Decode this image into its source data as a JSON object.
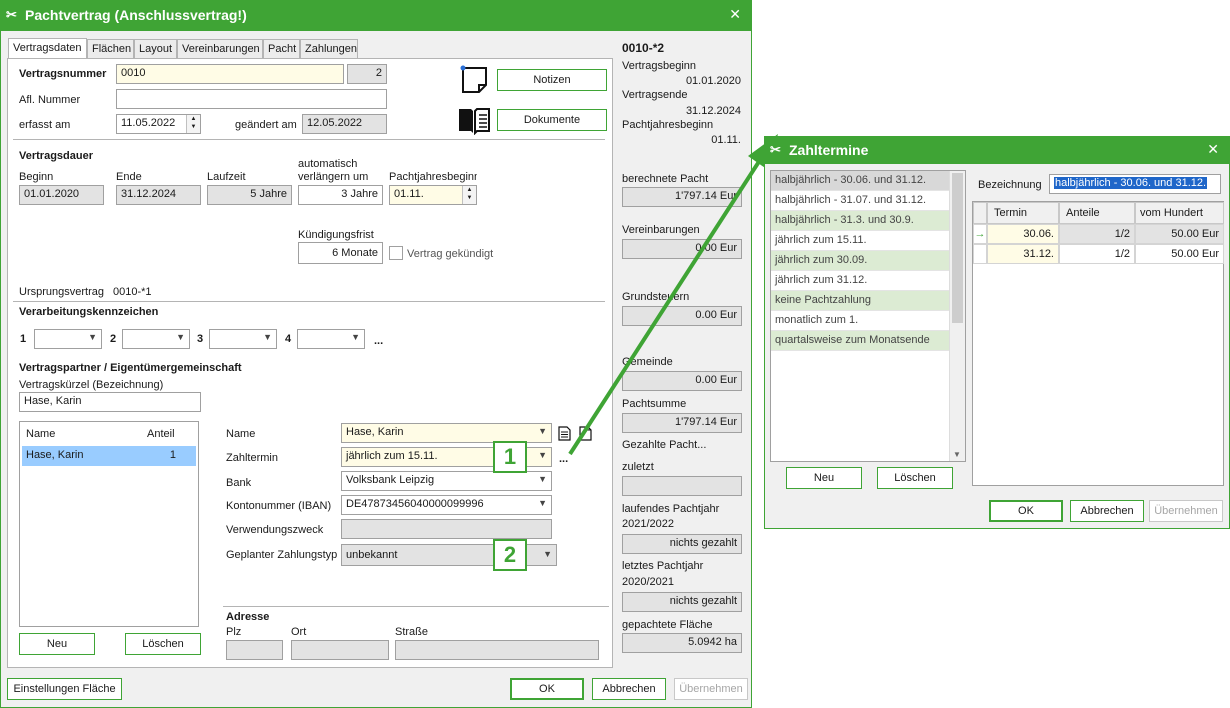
{
  "main_window": {
    "title": "Pachtvertrag (Anschlussvertrag!)",
    "close_glyph": "✕",
    "tabs": [
      "Vertragsdaten",
      "Flächen",
      "Layout",
      "Vereinbarungen",
      "Pacht",
      "Zahlungen"
    ],
    "contract": {
      "number_label": "Vertragsnummer",
      "number_value": "0010",
      "number_suffix": "2",
      "afl_label": "Afl. Nummer",
      "afl_value": "",
      "created_label": "erfasst am",
      "created_value": "11.05.2022",
      "changed_label": "geändert am",
      "changed_value": "12.05.2022",
      "notes_button": "Notizen",
      "docs_button": "Dokumente"
    },
    "duration": {
      "heading": "Vertragsdauer",
      "begin_label": "Beginn",
      "begin_value": "01.01.2020",
      "end_label": "Ende",
      "end_value": "31.12.2024",
      "term_label": "Laufzeit",
      "term_value": "5 Jahre",
      "auto_label_1": "automatisch",
      "auto_label_2": "verlängern um",
      "auto_value": "3 Jahre",
      "leaseyear_label": "Pachtjahresbeginn",
      "leaseyear_value": "01.11.",
      "notice_label": "Kündigungsfrist",
      "notice_value": "6 Monate",
      "terminated_label": "Vertrag gekündigt"
    },
    "origin": {
      "label": "Ursprungsvertrag",
      "value": "0010-*1"
    },
    "processing": {
      "heading": "Verarbeitungskennzeichen",
      "numbers": [
        "1",
        "2",
        "3",
        "4"
      ],
      "more": "..."
    },
    "partner": {
      "heading": "Vertragspartner / Eigentümergemeinschaft",
      "short_label": "Vertragskürzel (Bezeichnung)",
      "short_value": "Hase, Karin",
      "list_headers": [
        "Name",
        "Anteil"
      ],
      "list_rows": [
        {
          "name": "Hase, Karin",
          "share": "1"
        }
      ],
      "new_button": "Neu",
      "delete_button": "Löschen",
      "name_label": "Name",
      "name_value": "Hase, Karin",
      "payterm_label": "Zahltermin",
      "payterm_value": "jährlich zum 15.11.",
      "payterm_more": "...",
      "bank_label": "Bank",
      "bank_value": "Volksbank Leipzig",
      "iban_label": "Kontonummer (IBAN)",
      "iban_value": "DE47873456040000099996",
      "purpose_label": "Verwendungszweck",
      "purpose_value": "",
      "paytype_label": "Geplanter Zahlungstyp",
      "paytype_value": "unbekannt",
      "address_heading": "Adresse",
      "plz_label": "Plz",
      "city_label": "Ort",
      "street_label": "Straße"
    },
    "callouts": [
      "1",
      "2"
    ],
    "footer": {
      "settings_button": "Einstellungen Fläche",
      "ok_button": "OK",
      "cancel_button": "Abbrechen",
      "apply_button": "Übernehmen"
    },
    "side": {
      "id": "0010-*2",
      "begin_label": "Vertragsbeginn",
      "begin_value": "01.01.2020",
      "end_label": "Vertragsende",
      "end_value": "31.12.2024",
      "leaseyear_label": "Pachtjahresbeginn",
      "leaseyear_value": "01.11.",
      "calc_label": "berechnete Pacht",
      "calc_value": "1'797.14 Eur",
      "agree_label": "Vereinbarungen",
      "agree_value": "0.00 Eur",
      "tax_label": "Grundsteuern",
      "tax_value": "0.00 Eur",
      "community_label": "Gemeinde",
      "community_value": "0.00 Eur",
      "sum_label": "Pachtsumme",
      "sum_value": "1'797.14 Eur",
      "paid_label": "Gezahlte Pacht...",
      "last_label": "zuletzt",
      "last_value": "",
      "current_label_1": "laufendes Pachtjahr",
      "current_label_2": "2021/2022",
      "current_value": "nichts gezahlt",
      "prev_label_1": "letztes Pachtjahr",
      "prev_label_2": "2020/2021",
      "prev_value": "nichts gezahlt",
      "area_label": "gepachtete Fläche",
      "area_value": "5.0942 ha"
    }
  },
  "dialog": {
    "title": "Zahltermine",
    "close_glyph": "✕",
    "items": [
      "halbjährlich - 30.06. und 31.12.",
      "halbjährlich - 31.07. und 31.12.",
      "halbjährlich - 31.3. und 30.9.",
      "jährlich zum 15.11.",
      "jährlich zum 30.09.",
      "jährlich zum 31.12.",
      "keine Pachtzahlung",
      "monatlich zum 1.",
      "quartalsweise zum Monatsende"
    ],
    "designation_label": "Bezeichnung",
    "designation_value": "halbjährlich - 30.06. und 31.12.",
    "grid_headers": [
      "Termin",
      "Anteile",
      "vom Hundert"
    ],
    "grid_rows": [
      {
        "termin": "30.06.",
        "anteile": "1/2",
        "hundert": "50.00 Eur"
      },
      {
        "termin": "31.12.",
        "anteile": "1/2",
        "hundert": "50.00 Eur"
      }
    ],
    "new_button": "Neu",
    "delete_button": "Löschen",
    "ok_button": "OK",
    "cancel_button": "Abbrechen",
    "apply_button": "Übernehmen"
  },
  "colors": {
    "accent": "#3fa435",
    "highlight_green": "#dcebd3",
    "selection_blue": "#99ccff",
    "readonly_gray": "#e3e3e3",
    "input_yellow": "#fffce6"
  }
}
